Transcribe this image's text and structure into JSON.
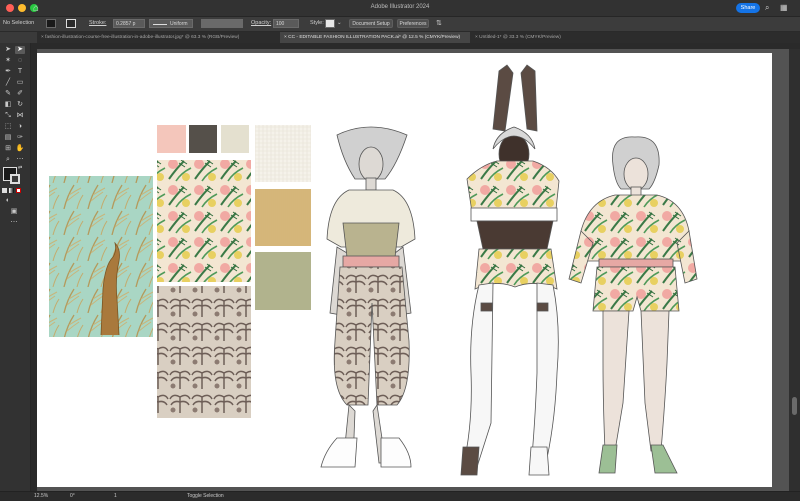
{
  "app": {
    "title": "Adobe Illustrator 2024",
    "share_label": "Share"
  },
  "window_controls": {
    "colors": [
      "#ff5f57",
      "#febc2e",
      "#28c840"
    ]
  },
  "control_bar": {
    "selection_label": "No Selection",
    "stroke_label": "Stroke:",
    "stroke_value": "0.2857 p",
    "uniform_label": "Uniform",
    "opacity_label": "Opacity:",
    "opacity_value": "100",
    "style_label": "Style:",
    "document_setup_label": "Document Setup",
    "preferences_label": "Preferences"
  },
  "tabs": [
    {
      "label": "fashion-illustration-course-free-illustration-in-adobe-illustrator.jpg* @ 63.3 % (RGB/Preview)",
      "close": "×"
    },
    {
      "label": "CC - EDITABLE FASHION ILLUSTRATION PACK.ai* @ 12.5 % (CMYK/Preview)",
      "close": "×"
    },
    {
      "label": "Untitled-1* @ 33.3 % (CMYK/Preview)",
      "close": "×"
    }
  ],
  "status_bar": {
    "zoom": "12.5%",
    "angle": "0°",
    "page": "1",
    "mode": "Toggle Selection"
  },
  "swatches": {
    "blush": "#f4c6bb",
    "charcoal": "#55504a",
    "cream": "#e4e0cf",
    "sage": "#b1b38d"
  },
  "icons": [
    "home-icon",
    "search-icon",
    "gear-icon",
    "chevron-down-icon",
    "grid-icon"
  ]
}
